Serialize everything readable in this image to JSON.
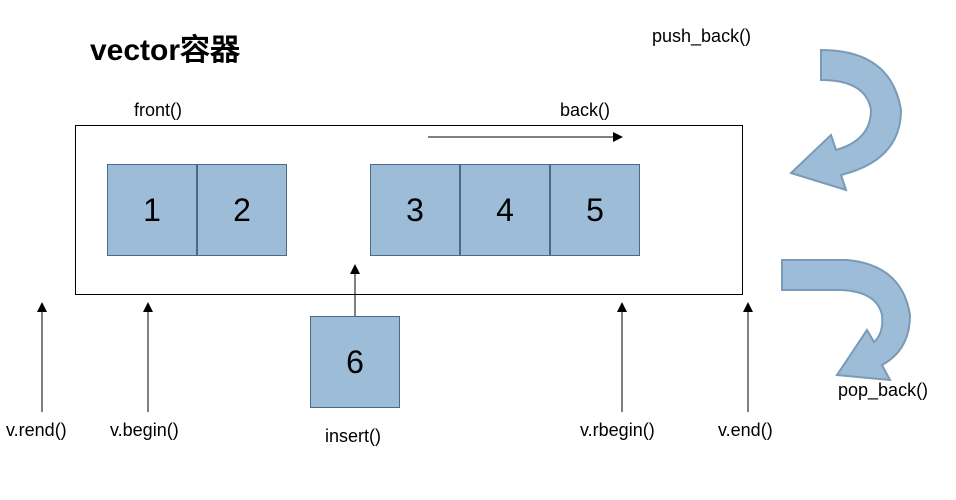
{
  "title": "vector容器",
  "cells": {
    "c1": "1",
    "c2": "2",
    "c3": "3",
    "c4": "4",
    "c5": "5",
    "c6": "6"
  },
  "labels": {
    "front": "front()",
    "back": "back()",
    "push_back": "push_back()",
    "pop_back": "pop_back()",
    "vrend": "v.rend()",
    "vbegin": "v.begin()",
    "insert": "insert()",
    "vrbegin": "v.rbegin()",
    "vend": "v.end()"
  },
  "colors": {
    "cell_fill": "#9dbcd8",
    "cell_border": "#4a6a8a",
    "curved_arrow_fill": "#9dbcd8",
    "curved_arrow_stroke": "#7a9ab6"
  }
}
